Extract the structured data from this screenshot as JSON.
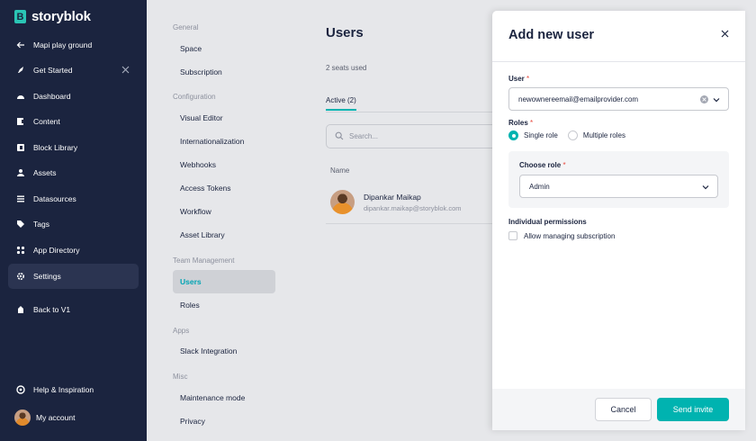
{
  "app": {
    "brand": "storyblok",
    "logo_letter": "B"
  },
  "sidebar": {
    "back_label": "Mapi play ground",
    "items": [
      {
        "label": "Get Started",
        "icon": "rocket-icon"
      },
      {
        "label": "Dashboard",
        "icon": "dashboard-icon"
      },
      {
        "label": "Content",
        "icon": "content-icon"
      },
      {
        "label": "Block Library",
        "icon": "blocks-icon"
      },
      {
        "label": "Assets",
        "icon": "assets-icon"
      },
      {
        "label": "Datasources",
        "icon": "datasources-icon"
      },
      {
        "label": "Tags",
        "icon": "tag-icon"
      },
      {
        "label": "App Directory",
        "icon": "apps-icon"
      },
      {
        "label": "Settings",
        "icon": "gear-icon",
        "active": true
      },
      {
        "label": "Back to V1",
        "icon": "back-v1-icon"
      }
    ],
    "help_label": "Help & Inspiration",
    "account_label": "My account"
  },
  "settings_menu": {
    "sections": {
      "general": "General",
      "configuration": "Configuration",
      "team": "Team Management",
      "apps": "Apps",
      "misc": "Misc"
    },
    "items": {
      "space": "Space",
      "subscription": "Subscription",
      "visual_editor": "Visual Editor",
      "internationalization": "Internationalization",
      "webhooks": "Webhooks",
      "access_tokens": "Access Tokens",
      "workflow": "Workflow",
      "asset_library": "Asset Library",
      "users": "Users",
      "roles": "Roles",
      "slack": "Slack Integration",
      "maintenance": "Maintenance mode",
      "privacy": "Privacy"
    },
    "active": "users"
  },
  "users_page": {
    "title": "Users",
    "seats": "2 seats used",
    "tab_active": "Active (2)",
    "search_placeholder": "Search...",
    "column_name": "Name",
    "user": {
      "name": "Dipankar Maikap",
      "email": "dipankar.maikap@storyblok.com"
    }
  },
  "modal": {
    "title": "Add new user",
    "user_label": "User",
    "user_value": "newownereemail@emailprovider.com",
    "roles_label": "Roles",
    "single_role": "Single role",
    "multiple_roles": "Multiple roles",
    "selected_mode": "single",
    "choose_role_label": "Choose role",
    "role_value": "Admin",
    "permissions_label": "Individual permissions",
    "permission_option": "Allow managing subscription",
    "required_mark": "*",
    "cancel_label": "Cancel",
    "send_label": "Send invite"
  },
  "colors": {
    "sidebar_bg": "#1b243f",
    "accent": "#00b3b0",
    "required": "#e7473c"
  }
}
